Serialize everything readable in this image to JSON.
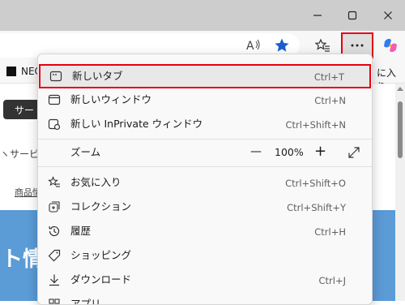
{
  "favorites_bar": {
    "item1": "NEC",
    "item2": "に入り"
  },
  "page": {
    "nav_button": "サー",
    "nav_link": "ヽサービ",
    "link": "商品情",
    "banner": "ト情"
  },
  "menu": {
    "new_tab": {
      "label": "新しいタブ",
      "shortcut": "Ctrl+T"
    },
    "new_window": {
      "label": "新しいウィンドウ",
      "shortcut": "Ctrl+N"
    },
    "new_inprivate": {
      "label": "新しい InPrivate ウィンドウ",
      "shortcut": "Ctrl+Shift+N"
    },
    "zoom": {
      "label": "ズーム",
      "minus": "—",
      "value": "100%",
      "plus": "+"
    },
    "favorites": {
      "label": "お気に入り",
      "shortcut": "Ctrl+Shift+O"
    },
    "collections": {
      "label": "コレクション",
      "shortcut": "Ctrl+Shift+Y"
    },
    "history": {
      "label": "履歴",
      "shortcut": "Ctrl+H"
    },
    "shopping": {
      "label": "ショッピング"
    },
    "downloads": {
      "label": "ダウンロード",
      "shortcut": "Ctrl+J"
    },
    "apps": {
      "label": "アプリ"
    }
  },
  "colors": {
    "highlight_border": "#e60012",
    "favorite_star": "#1a5fd0",
    "banner": "#5b9bd6"
  },
  "icons": [
    "minimize-icon",
    "maximize-icon",
    "close-icon",
    "read-aloud-icon",
    "favorite-star-icon",
    "favorites-icon",
    "more-icon",
    "copilot-icon"
  ]
}
